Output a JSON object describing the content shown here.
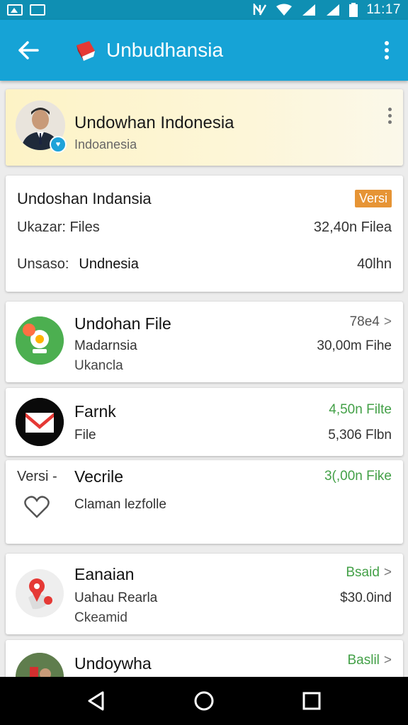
{
  "status_bar": {
    "time": "11:17"
  },
  "app_bar": {
    "title": "Unbudhansia",
    "back_icon": "arrow-left-icon",
    "menu_icon": "more-vert-icon"
  },
  "profile": {
    "name": "Undowhan Indonesia",
    "subtitle": "Indoanesia"
  },
  "info": {
    "title": "Undoshan Indansia",
    "badge": "Versi",
    "row1": {
      "label": "Ukazar: Files",
      "amount": "32,40n Filea"
    },
    "row2": {
      "label": "Unsaso:",
      "value": "Undnesia",
      "amount": "40lhn"
    }
  },
  "items": [
    {
      "title": "Undohan File",
      "line1": "Madarnsia",
      "line2": "Ukancla",
      "right1": "78e4",
      "right2": "30,00m Fihe",
      "chevron": ">"
    },
    {
      "title": "Farnk",
      "line1": "File",
      "right1": "4,50n Filte",
      "right2": "5,306 Flbn"
    },
    {
      "prefix": "Versi -",
      "title": "Vecrile",
      "line1": "Claman lezfolle",
      "right1": "3(,00n Fike"
    },
    {
      "title": "Eanaian",
      "line1": "Uahau Rearla",
      "line2": "Ckeamid",
      "right1": "Bsaid",
      "right2": "$30.0ind",
      "chevron": ">"
    },
    {
      "title": "Undoywha",
      "right1": "Baslil",
      "chevron": ">"
    }
  ],
  "colors": {
    "app_bar": "#16a3d6",
    "status_bar": "#0f8fb3",
    "badge": "#e69435",
    "green": "#43a047"
  }
}
